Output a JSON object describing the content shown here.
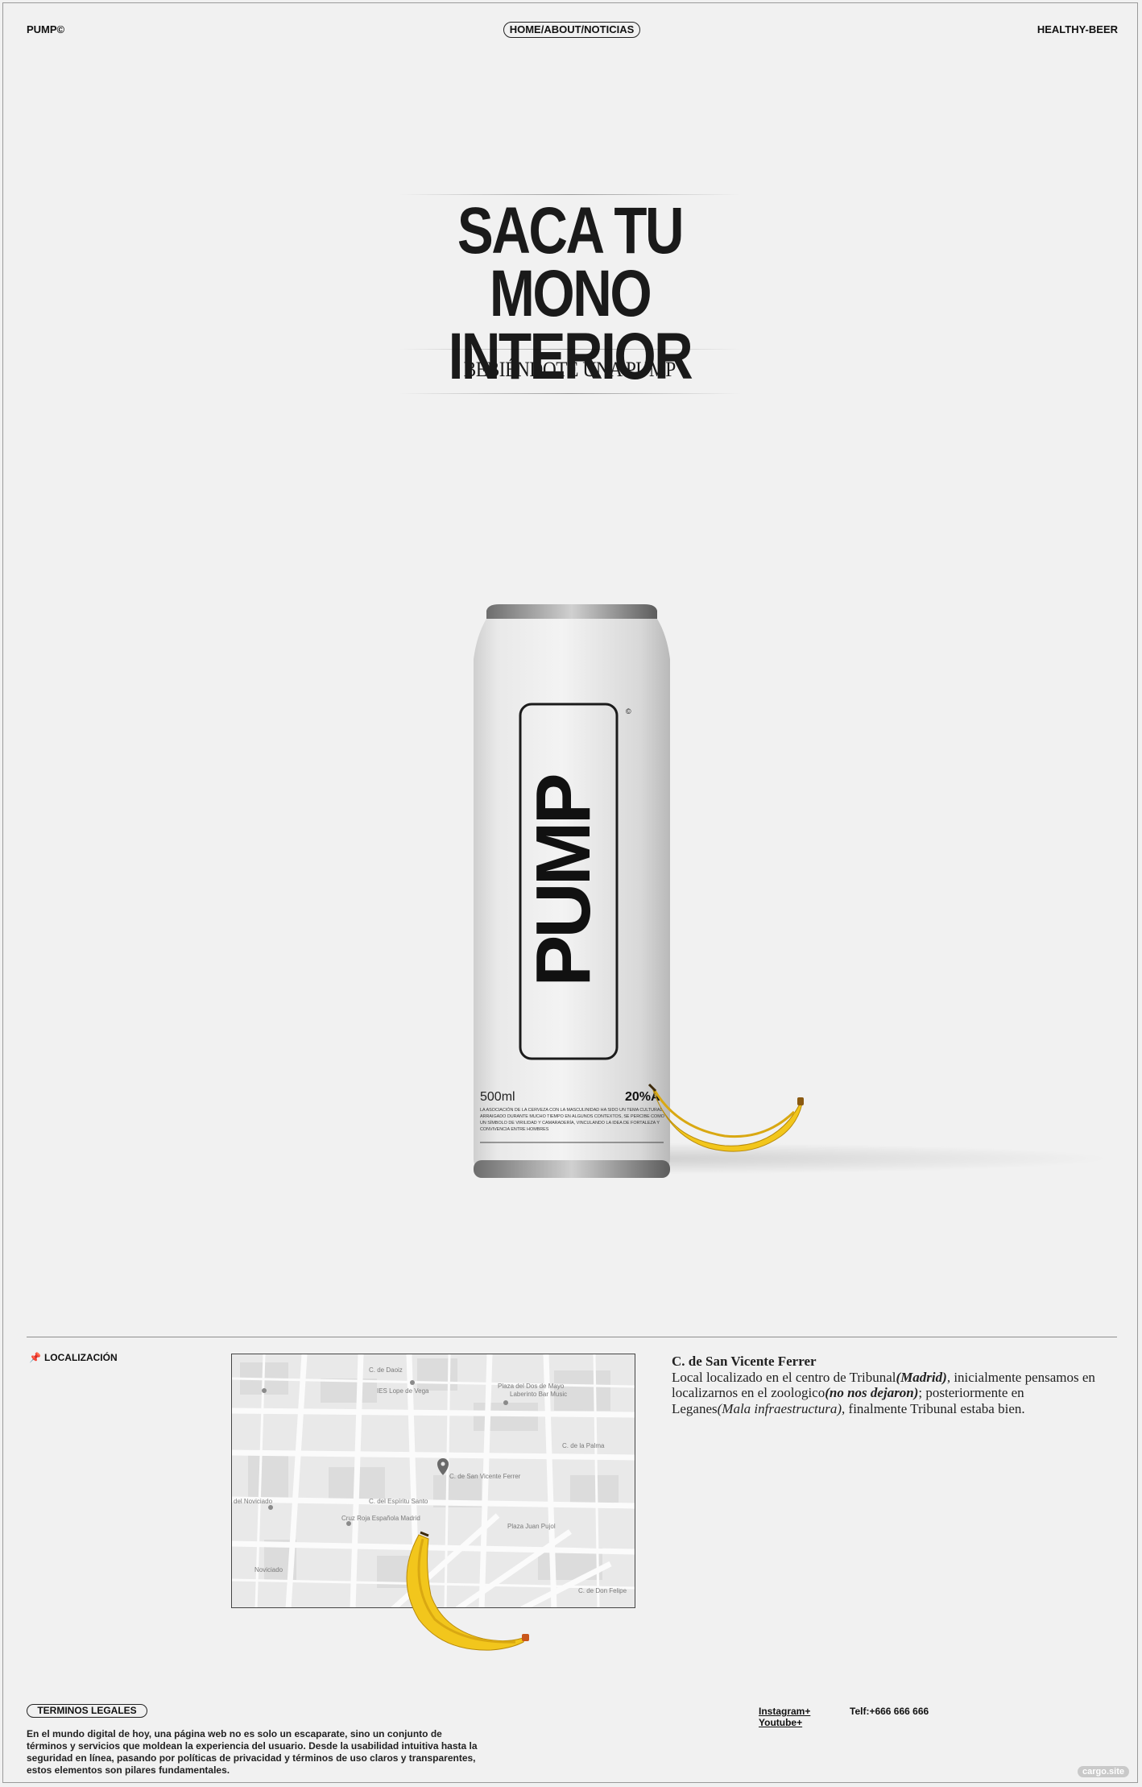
{
  "header": {
    "brand": "PUMP©",
    "nav": "HOME/ABOUT/NOTICIAS",
    "tagline": "HEALTHY-BEER"
  },
  "hero": {
    "title_line1": "SACA TU",
    "title_line2": "MONO INTERIOR",
    "subtitle": "BEBIÉNDOTE UNA PUMP"
  },
  "product": {
    "can_logo": "PUMP",
    "volume": "500ml",
    "abv": "20%A",
    "can_copy": "LA ASOCIACIÓN DE LA CERVEZA CON LA MASCULINIDAD HA SIDO UN TEMA CULTURAL ARRAIGADO DURANTE MUCHO TIEMPO EN ALGUNOS CONTEXTOS, SE PERCIBE COMO UN SÍMBOLO DE VIRILIDAD Y CAMARADERÍA, VINCULANDO LA IDEA DE FORTALEZA Y CONVIVENCIA ENTRE HOMBRES",
    "banana_icon": "banana-icon"
  },
  "location": {
    "label": "LOCALIZACIÓN",
    "pin_icon": "pin-icon",
    "map_labels": {
      "street1": "C. de Daoiz",
      "school": "IES Lope de Vega",
      "plaza": "Plaza del Dos de Mayo",
      "bar": "Laberinto Bar Music",
      "street2": "C. de la Palma",
      "marker": "C. de San Vicente Ferrer",
      "street3": "C. del Espíritu Santo",
      "cruz_roja": "Cruz Roja Española Madrid",
      "noviciado": "Noviciado",
      "plaza2": "Plaza Juan Pujol",
      "street4": "C. de Don Felipe",
      "left_label": "del Noviciado"
    },
    "address_title": "C. de San Vicente Ferrer",
    "address_text_1": "Local localizado en el centro de Tribunal",
    "address_em_1": "(Madrid)",
    "address_text_2": ", inicialmente pensamos en localizarnos en el zoologico",
    "address_em_2": "(no nos dejaron)",
    "address_text_3": "; posteriormente en Leganes",
    "address_em_3": "(Mala infraestructura)",
    "address_text_4": ", finalmente Tribunal estaba bien."
  },
  "footer": {
    "legal_button": "TERMINOS LEGALES",
    "legal_text": "En el mundo digital de hoy, una  página web no es solo un escaparate, sino un conjunto de términos y servicios que moldean la experiencia del usuario. Desde la usabilidad intuitiva hasta la seguridad en línea, pasando por políticas de privacidad y términos de uso claros y transparentes, estos elementos son pilares fundamentales.",
    "instagram": "Instagram+",
    "youtube": "Youtube+",
    "phone": "Telf:+666 666 666",
    "badge": "cargo.site"
  }
}
